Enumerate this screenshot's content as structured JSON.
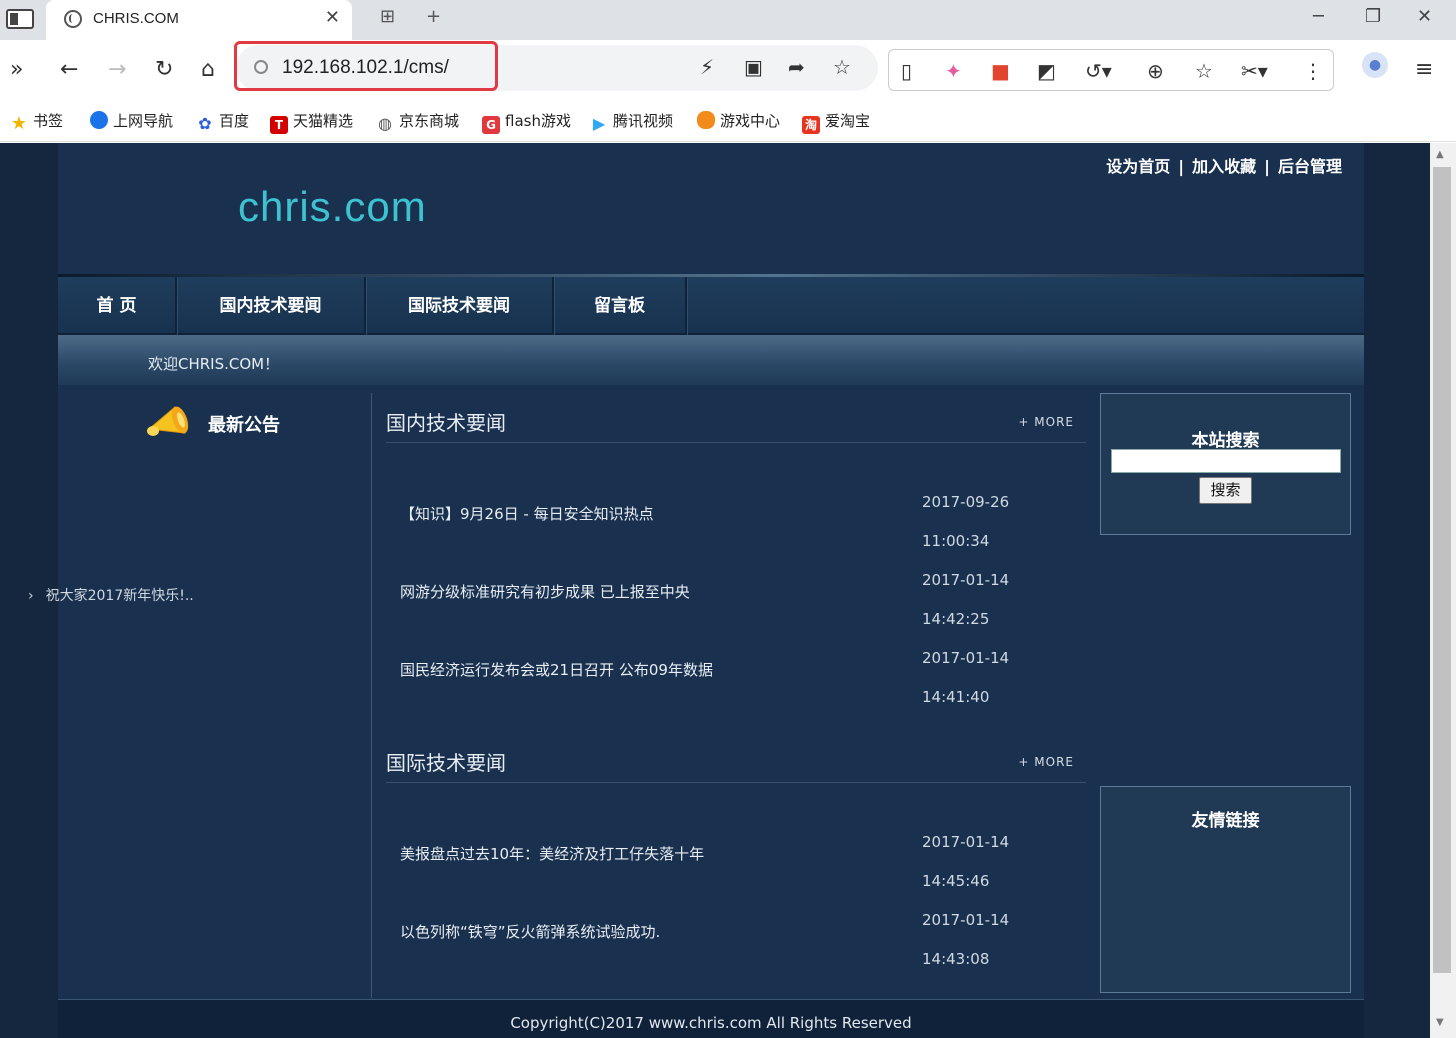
{
  "browser": {
    "tab_title": "CHRIS.COM",
    "url": "192.168.102.1/cms/",
    "bookmarks": [
      {
        "label": "书签",
        "icon": "star-icon",
        "color": "#f5b400"
      },
      {
        "label": "上网导航",
        "icon": "nav-icon",
        "color": "#1a73e8"
      },
      {
        "label": "百度",
        "icon": "baidu-icon",
        "color": "#2b5fd9"
      },
      {
        "label": "天猫精选",
        "icon": "tmall-icon",
        "color": "#d40000"
      },
      {
        "label": "京东商城",
        "icon": "globe-icon",
        "color": "#555555"
      },
      {
        "label": "flash游戏",
        "icon": "flash-game-icon",
        "color": "#e0383e"
      },
      {
        "label": "腾讯视频",
        "icon": "tencent-video-icon",
        "color": "#2fa9f5"
      },
      {
        "label": "游戏中心",
        "icon": "game-center-icon",
        "color": "#f28a1c"
      },
      {
        "label": "爱淘宝",
        "icon": "taobao-icon",
        "color": "#e8331e"
      }
    ]
  },
  "site": {
    "header_links": [
      "设为首页",
      "加入收藏",
      "后台管理"
    ],
    "header_sep": "|",
    "logo": "chris.com",
    "nav": [
      "首 页",
      "国内技术要闻",
      "国际技术要闻",
      "留言板"
    ],
    "welcome": "欢迎CHRIS.COM！",
    "announce": {
      "title": "最新公告",
      "items": [
        "祝大家2017新年快乐!.."
      ]
    },
    "domestic": {
      "title": "国内技术要闻",
      "more": "+ MORE",
      "items": [
        {
          "title": "【知识】9月26日 - 每日安全知识热点",
          "date": "2017-09-26",
          "time": "11:00:34"
        },
        {
          "title": "网游分级标准研究有初步成果 已上报至中央",
          "date": "2017-01-14",
          "time": "14:42:25"
        },
        {
          "title": "国民经济运行发布会或21日召开 公布09年数据",
          "date": "2017-01-14",
          "time": "14:41:40"
        }
      ]
    },
    "international": {
      "title": "国际技术要闻",
      "more": "+ MORE",
      "items": [
        {
          "title": "美报盘点过去10年：美经济及打工仔失落十年",
          "date": "2017-01-14",
          "time": "14:45:46"
        },
        {
          "title": "以色列称“铁穹”反火箭弹系统试验成功.",
          "date": "2017-01-14",
          "time": "14:43:08"
        }
      ]
    },
    "search": {
      "title": "本站搜索",
      "button": "搜索",
      "value": ""
    },
    "links": {
      "title": "友情链接"
    },
    "footer": "Copyright(C)2017 www.chris.com All Rights Reserved"
  },
  "colors": {
    "page_bg": "#15273f",
    "logo": "#3ec2cf",
    "highlight_box": "#e03a45"
  }
}
